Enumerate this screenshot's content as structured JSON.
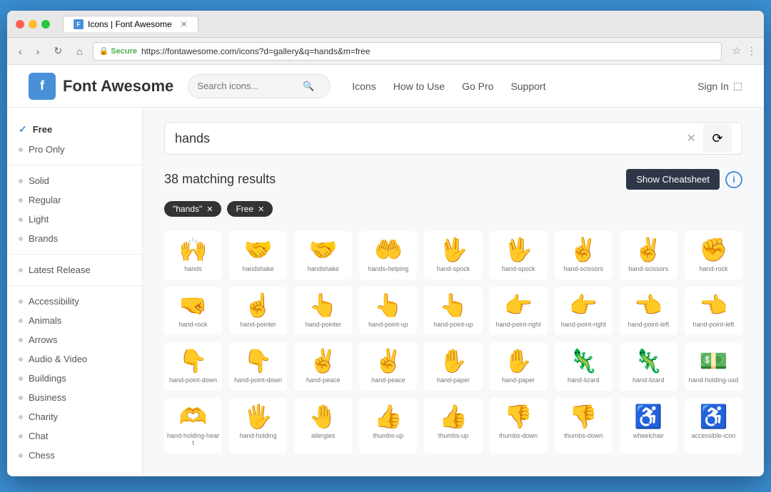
{
  "window": {
    "title": "Icons | Font Awesome",
    "url": "https://fontawesome.com/icons?d=gallery&q=hands&m=free"
  },
  "header": {
    "logo_text": "Font Awesome",
    "search_placeholder": "Search icons...",
    "nav": [
      "Icons",
      "How to Use",
      "Go Pro",
      "Support"
    ],
    "sign_in": "Sign In"
  },
  "sidebar": {
    "free_label": "Free",
    "pro_only_label": "Pro Only",
    "styles": [
      "Solid",
      "Regular",
      "Light",
      "Brands"
    ],
    "latest_release": "Latest Release",
    "categories": [
      "Accessibility",
      "Animals",
      "Arrows",
      "Audio & Video",
      "Buildings",
      "Business",
      "Charity",
      "Chat",
      "Chess"
    ]
  },
  "content": {
    "search_value": "hands",
    "results_count": "38 matching results",
    "cheatsheet_btn": "Show Cheatsheet",
    "tags": [
      {
        "label": "\"hands\""
      },
      {
        "label": "Free"
      }
    ],
    "icons": [
      {
        "label": "hands",
        "glyph": "🙌"
      },
      {
        "label": "handshake",
        "glyph": "🤝"
      },
      {
        "label": "handshake",
        "glyph": "🤝"
      },
      {
        "label": "hands-helping",
        "glyph": "🤲"
      },
      {
        "label": "hand-spock",
        "glyph": "🖖"
      },
      {
        "label": "hand-spock",
        "glyph": "🖖"
      },
      {
        "label": "hand-scissors",
        "glyph": "✌"
      },
      {
        "label": "hand-scissors",
        "glyph": "✌"
      },
      {
        "label": "hand-rock",
        "glyph": "✊"
      },
      {
        "label": "hand-rock",
        "glyph": "🤜"
      },
      {
        "label": "hand-pointer",
        "glyph": "☝"
      },
      {
        "label": "hand-pointer",
        "glyph": "👆"
      },
      {
        "label": "hand-point-up",
        "glyph": "👆"
      },
      {
        "label": "hand-point-up",
        "glyph": "👆"
      },
      {
        "label": "hand-point-right",
        "glyph": "👉"
      },
      {
        "label": "hand-point-right",
        "glyph": "👉"
      },
      {
        "label": "hand-point-left",
        "glyph": "👈"
      },
      {
        "label": "hand-point-left",
        "glyph": "👈"
      },
      {
        "label": "hand-point-down",
        "glyph": "👇"
      },
      {
        "label": "hand-point-down",
        "glyph": "👇"
      },
      {
        "label": "hand-peace",
        "glyph": "✌"
      },
      {
        "label": "hand-peace",
        "glyph": "✌"
      },
      {
        "label": "hand-paper",
        "glyph": "✋"
      },
      {
        "label": "hand-paper",
        "glyph": "✋"
      },
      {
        "label": "hand-lizard",
        "glyph": "🦎"
      },
      {
        "label": "hand-lizard",
        "glyph": "🦎"
      },
      {
        "label": "hand-holding-usd",
        "glyph": "💵"
      },
      {
        "label": "hand-holding-heart",
        "glyph": "🫶"
      },
      {
        "label": "hand-holding",
        "glyph": "🖐"
      },
      {
        "label": "allergies",
        "glyph": "🤚"
      },
      {
        "label": "thumbs-up",
        "glyph": "👍"
      },
      {
        "label": "thumbs-up",
        "glyph": "👍"
      },
      {
        "label": "thumbs-down",
        "glyph": "👎"
      },
      {
        "label": "thumbs-down",
        "glyph": "👎"
      },
      {
        "label": "wheelchair",
        "glyph": "♿"
      },
      {
        "label": "accessible-icon",
        "glyph": "♿"
      }
    ]
  }
}
